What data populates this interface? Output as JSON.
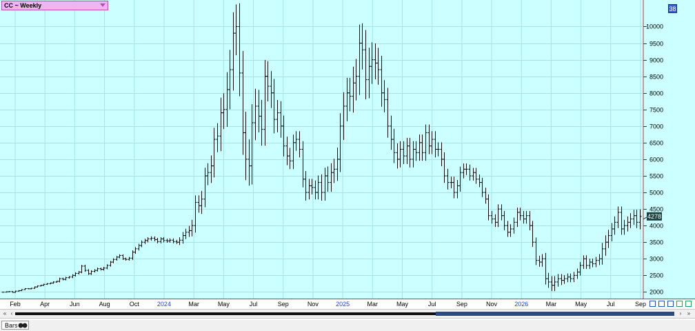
{
  "window": {
    "symbol_title": "CC ~ Weekly",
    "badge": "38"
  },
  "status": {
    "tab_label": "Bars"
  },
  "colors": {
    "background": "#ccffff",
    "grid": "#a6e4e4",
    "bars": "#000000",
    "year_label": "#1f3fcf",
    "axis_border": "#c83232",
    "last_label_bg": "#1a4040"
  },
  "chart_data": {
    "type": "bar",
    "subtype": "ohlc",
    "title": "CC ~ Weekly",
    "ylim": [
      1800,
      10800
    ],
    "grid": true,
    "y_ticks": [
      "2000",
      "2500",
      "3000",
      "3500",
      "4000",
      "4500",
      "5000",
      "5500",
      "6000",
      "6500",
      "7000",
      "7500",
      "8000",
      "8500",
      "9000",
      "9500",
      "10000"
    ],
    "x_ticks": [
      {
        "label": "Feb",
        "year": false
      },
      {
        "label": "Apr",
        "year": false
      },
      {
        "label": "Jun",
        "year": false
      },
      {
        "label": "Aug",
        "year": false
      },
      {
        "label": "Oct",
        "year": false
      },
      {
        "label": "2024",
        "year": true
      },
      {
        "label": "Mar",
        "year": false
      },
      {
        "label": "May",
        "year": false
      },
      {
        "label": "Jul",
        "year": false
      },
      {
        "label": "Sep",
        "year": false
      },
      {
        "label": "Nov",
        "year": false
      },
      {
        "label": "2025",
        "year": true
      },
      {
        "label": "Mar",
        "year": false
      },
      {
        "label": "May",
        "year": false
      },
      {
        "label": "Jul",
        "year": false
      },
      {
        "label": "Sep",
        "year": false
      },
      {
        "label": "Nov",
        "year": false
      },
      {
        "label": "2026",
        "year": true
      },
      {
        "label": "Mar",
        "year": false
      },
      {
        "label": "May",
        "year": false
      },
      {
        "label": "Jul",
        "year": false
      },
      {
        "label": "Sep",
        "year": false
      }
    ],
    "last_value": "4278",
    "series": [
      {
        "close": [
          1995,
          2005,
          2010,
          1990,
          2025,
          2040,
          2070,
          2100,
          2095,
          2110,
          2150,
          2180,
          2200,
          2230,
          2250,
          2270,
          2300,
          2320,
          2400,
          2380,
          2430,
          2450,
          2500,
          2560,
          2600,
          2780,
          2650,
          2550,
          2620,
          2650,
          2700,
          2680,
          2720,
          2800,
          2900,
          2980,
          3050,
          3100,
          3000,
          2980,
          3020,
          3200,
          3300,
          3400,
          3500,
          3550,
          3600,
          3620,
          3580,
          3520,
          3600,
          3550,
          3540,
          3560,
          3520,
          3500,
          3560,
          3700,
          3800,
          3850,
          4000,
          4700,
          4600,
          4800,
          5500,
          5600,
          5800,
          6600,
          6700,
          7400,
          7500,
          8100,
          8700,
          9800,
          10000,
          8600,
          6800,
          6000,
          5800,
          7100,
          7600,
          7300,
          6900,
          8500,
          8200,
          8000,
          7200,
          7400,
          7000,
          6400,
          6100,
          5950,
          6500,
          6600,
          6300,
          5400,
          5000,
          5200,
          5150,
          5000,
          5300,
          5000,
          5500,
          5300,
          5600,
          5700,
          6000,
          7000,
          7600,
          8000,
          7900,
          8300,
          8500,
          9500,
          9300,
          8400,
          8800,
          9000,
          8900,
          8700,
          8000,
          7800,
          7000,
          6600,
          6200,
          6000,
          6300,
          6100,
          6400,
          6000,
          6300,
          6200,
          6500,
          6200,
          6800,
          6400,
          6600,
          6300,
          6300,
          6000,
          5500,
          5300,
          5300,
          5000,
          5200,
          5600,
          5700,
          5700,
          5500,
          5600,
          5400,
          5300,
          5000,
          4800,
          4300,
          4200,
          4100,
          4500,
          4300,
          4000,
          3800,
          3900,
          4100,
          4400,
          4300,
          4200,
          4300,
          4000,
          3500,
          2950,
          2900,
          3000,
          2400,
          2300,
          2200,
          2300,
          2400,
          2350,
          2400,
          2450,
          2400,
          2500,
          2600,
          2800,
          3000,
          2800,
          2900,
          2850,
          2950,
          3000,
          3300,
          3500,
          3700,
          3900,
          4100,
          4400,
          3900,
          4000,
          4100,
          4200,
          4300,
          4100,
          4278
        ],
        "spread": [
          40,
          35,
          40,
          40,
          40,
          40,
          40,
          40,
          40,
          40,
          50,
          50,
          50,
          50,
          50,
          50,
          60,
          60,
          80,
          80,
          80,
          80,
          90,
          90,
          100,
          100,
          120,
          100,
          100,
          100,
          100,
          100,
          100,
          100,
          100,
          100,
          100,
          100,
          100,
          100,
          100,
          150,
          150,
          150,
          150,
          150,
          150,
          150,
          150,
          150,
          150,
          150,
          150,
          150,
          150,
          150,
          250,
          300,
          300,
          400,
          500,
          600,
          600,
          700,
          700,
          800,
          900,
          1000,
          1100,
          1300,
          1400,
          1500,
          1700,
          1800,
          1900,
          2000,
          1900,
          1800,
          1700,
          1600,
          1500,
          1400,
          1400,
          1400,
          1300,
          1300,
          1200,
          1100,
          1000,
          900,
          800,
          700,
          700,
          700,
          700,
          700,
          700,
          600,
          600,
          600,
          600,
          700,
          700,
          800,
          800,
          900,
          1000,
          1100,
          1200,
          1300,
          1300,
          1400,
          1500,
          1600,
          1700,
          1700,
          1600,
          1500,
          1400,
          1300,
          1200,
          1100,
          1000,
          900,
          900,
          800,
          700,
          700,
          700,
          700,
          700,
          700,
          700,
          700,
          700,
          700,
          700,
          700,
          600,
          600,
          600,
          600,
          500,
          500,
          500,
          500,
          500,
          500,
          400,
          400,
          400,
          400,
          400,
          400,
          400,
          400,
          400,
          400,
          400,
          400,
          400,
          400,
          400,
          400,
          400,
          400,
          400,
          400,
          400,
          400,
          400,
          400,
          500,
          500,
          500,
          500,
          400,
          400,
          300,
          300,
          300,
          300,
          300,
          300,
          300,
          300,
          300,
          300,
          300,
          400,
          500,
          600,
          500,
          500,
          500,
          500,
          500,
          500,
          500,
          500,
          500,
          500,
          600,
          600,
          500,
          500,
          500,
          400,
          400,
          400,
          300
        ]
      }
    ]
  }
}
